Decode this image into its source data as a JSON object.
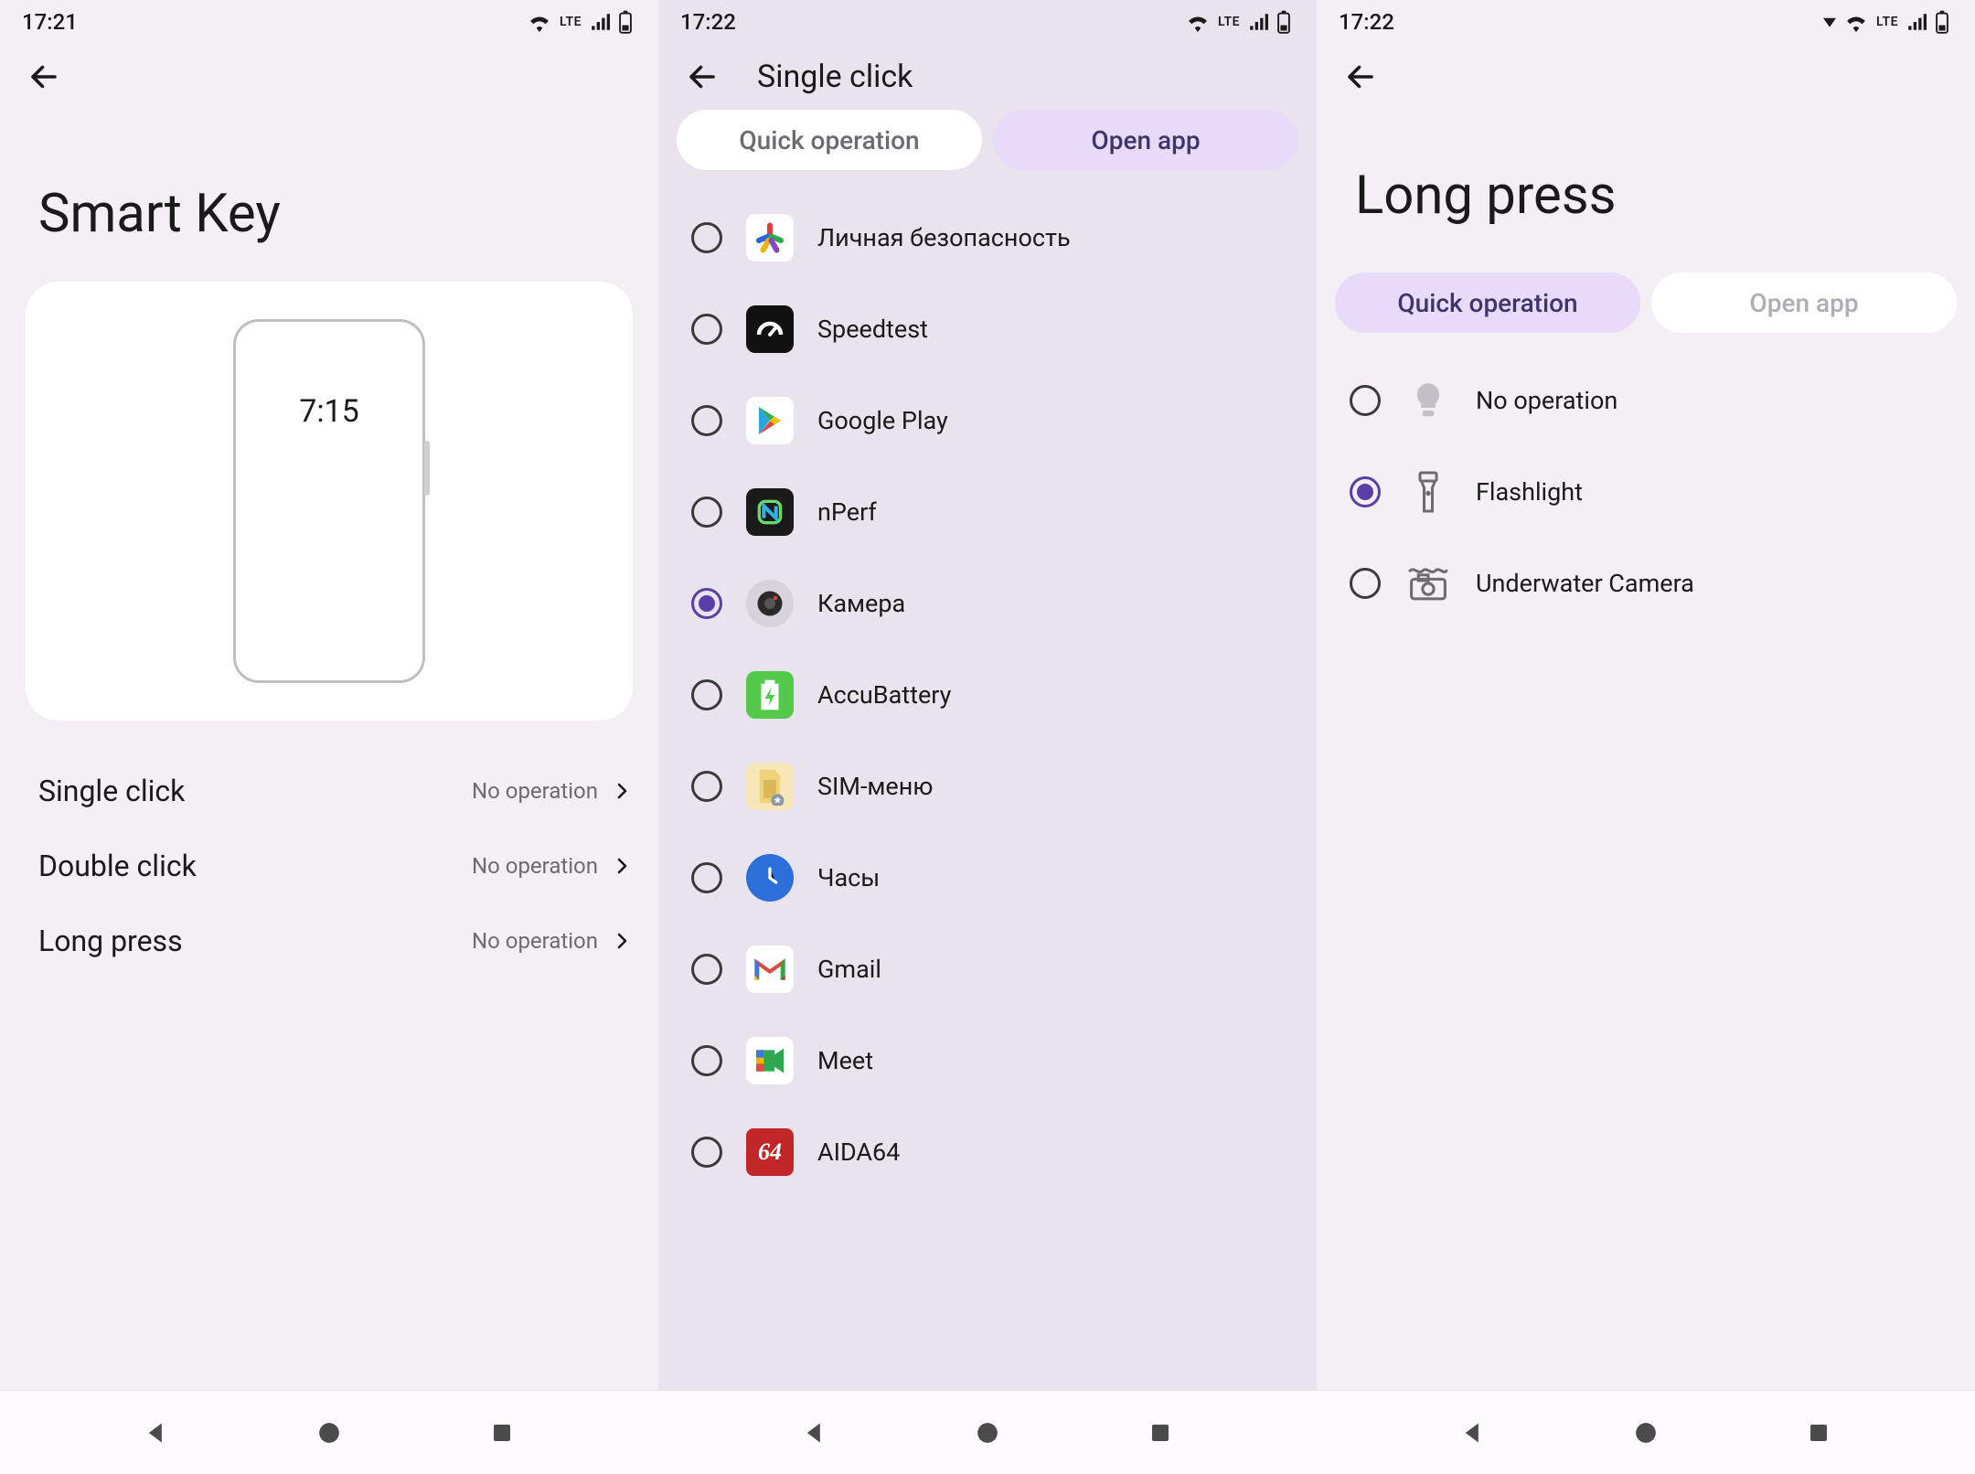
{
  "screen1": {
    "status_time": "17:21",
    "title": "Smart Key",
    "preview_time": "7:15",
    "rows": [
      {
        "label": "Single click",
        "value": "No operation"
      },
      {
        "label": "Double click",
        "value": "No operation"
      },
      {
        "label": "Long press",
        "value": "No operation"
      }
    ]
  },
  "screen2": {
    "status_time": "17:22",
    "title": "Single click",
    "tabs": {
      "quick": "Quick operation",
      "open": "Open app"
    },
    "selected_tab": "open",
    "apps": [
      {
        "label": "Личная безопасность",
        "selected": false,
        "icon": "safety"
      },
      {
        "label": "Speedtest",
        "selected": false,
        "icon": "speed"
      },
      {
        "label": "Google Play",
        "selected": false,
        "icon": "play"
      },
      {
        "label": "nPerf",
        "selected": false,
        "icon": "nperf"
      },
      {
        "label": "Камера",
        "selected": true,
        "icon": "camera"
      },
      {
        "label": "AccuBattery",
        "selected": false,
        "icon": "accu"
      },
      {
        "label": "SIM-меню",
        "selected": false,
        "icon": "sim"
      },
      {
        "label": "Часы",
        "selected": false,
        "icon": "clock"
      },
      {
        "label": "Gmail",
        "selected": false,
        "icon": "gmail"
      },
      {
        "label": "Meet",
        "selected": false,
        "icon": "meet"
      },
      {
        "label": "AIDA64",
        "selected": false,
        "icon": "aida"
      }
    ]
  },
  "screen3": {
    "status_time": "17:22",
    "title": "Long press",
    "tabs": {
      "quick": "Quick operation",
      "open": "Open app"
    },
    "selected_tab": "quick",
    "ops": [
      {
        "label": "No operation",
        "selected": false,
        "icon": "bulb"
      },
      {
        "label": "Flashlight",
        "selected": true,
        "icon": "flash"
      },
      {
        "label": "Underwater Camera",
        "selected": false,
        "icon": "uwcam"
      }
    ]
  },
  "icons": {
    "aida_text": "64"
  }
}
